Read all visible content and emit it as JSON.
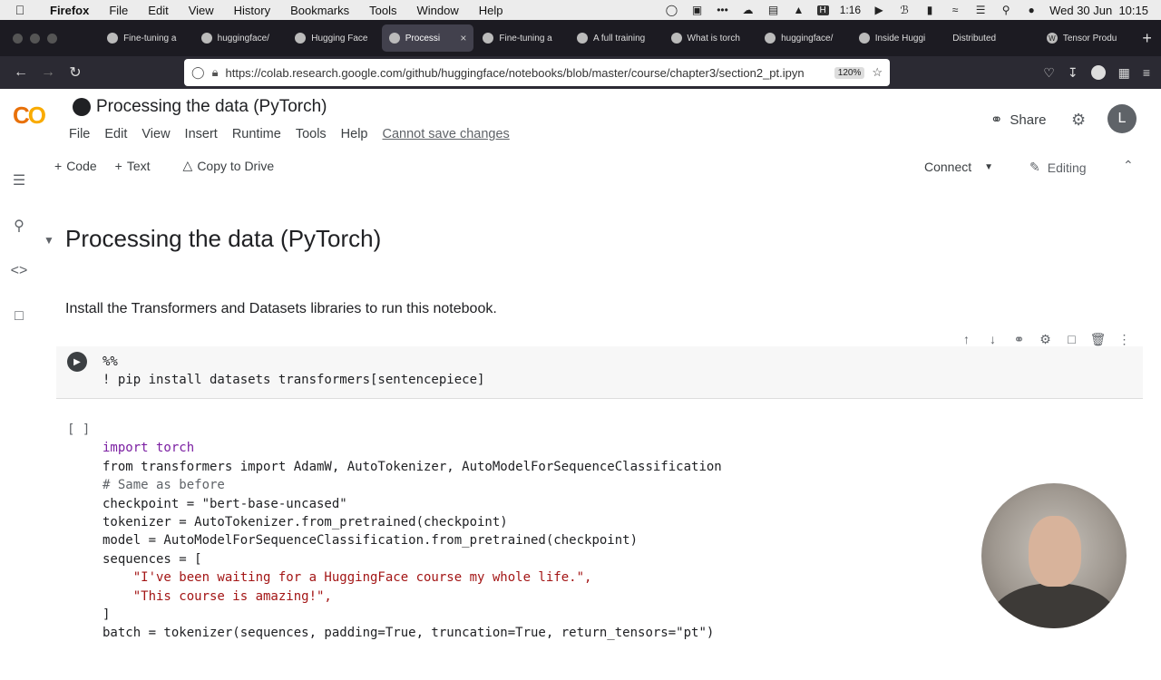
{
  "mac_menubar": {
    "app": "Firefox",
    "items": [
      "File",
      "Edit",
      "View",
      "History",
      "Bookmarks",
      "Tools",
      "Window",
      "Help"
    ],
    "battery_text": "1:16",
    "clock": "Wed 30 Jun  10:15"
  },
  "tabs": [
    {
      "label": "Fine-tuning a",
      "active": false
    },
    {
      "label": "huggingface/",
      "active": false
    },
    {
      "label": "Hugging Face",
      "active": false
    },
    {
      "label": "Processi",
      "active": true
    },
    {
      "label": "Fine-tuning a",
      "active": false
    },
    {
      "label": "A full training",
      "active": false
    },
    {
      "label": "What is torch",
      "active": false
    },
    {
      "label": "huggingface/",
      "active": false
    },
    {
      "label": "Inside Huggi",
      "active": false
    },
    {
      "label": "Distributed",
      "active": false
    },
    {
      "label": "Tensor Produ",
      "active": false
    }
  ],
  "url": {
    "text": "https://colab.research.google.com/github/huggingface/notebooks/blob/master/course/chapter3/section2_pt.ipyn",
    "zoom": "120%"
  },
  "colab": {
    "title": "Processing the data (PyTorch)",
    "menu": [
      "File",
      "Edit",
      "View",
      "Insert",
      "Runtime",
      "Tools",
      "Help"
    ],
    "cannot_save": "Cannot save changes",
    "share": "Share",
    "avatar_letter": "L",
    "toolbar": {
      "code": "Code",
      "text": "Text",
      "copy": "Copy to Drive"
    },
    "connect": "Connect",
    "editing": "Editing"
  },
  "notebook": {
    "section_title": "Processing the data (PyTorch)",
    "paragraph": "Install the Transformers and Datasets libraries to run this notebook.",
    "cell1_lines": [
      "%%",
      "! pip install datasets transformers[sentencepiece]"
    ],
    "cell2_brackets": "[ ]",
    "cell2_lines": [
      "import torch",
      "from transformers import AdamW, AutoTokenizer, AutoModelForSequenceClassification",
      "",
      "# Same as before",
      "checkpoint = \"bert-base-uncased\"",
      "tokenizer = AutoTokenizer.from_pretrained(checkpoint)",
      "model = AutoModelForSequenceClassification.from_pretrained(checkpoint)",
      "sequences = [",
      "    \"I've been waiting for a HuggingFace course my whole life.\",",
      "    \"This course is amazing!\",",
      "]",
      "batch = tokenizer(sequences, padding=True, truncation=True, return_tensors=\"pt\")"
    ]
  }
}
